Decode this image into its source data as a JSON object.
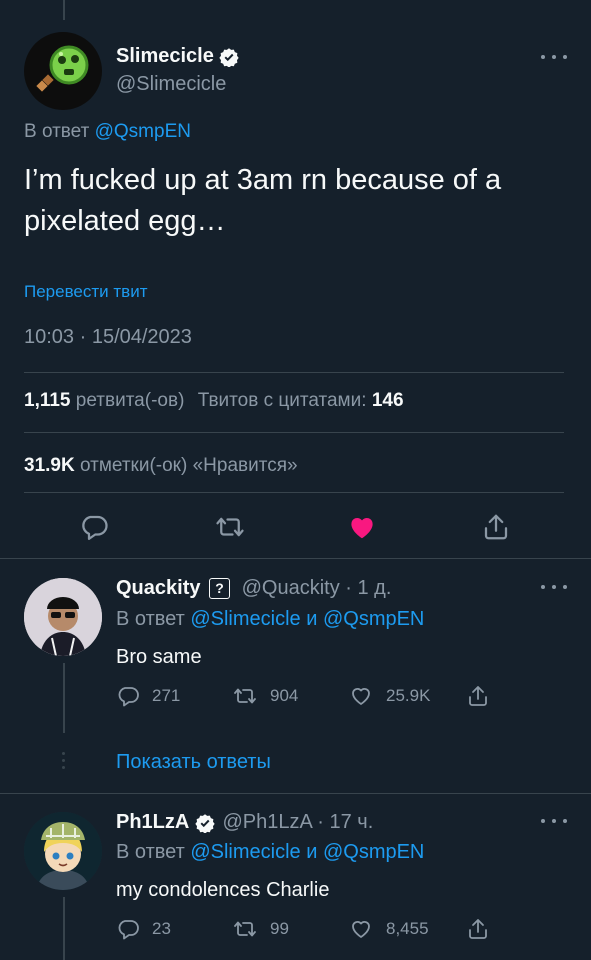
{
  "main_tweet": {
    "display_name": "Slimecicle",
    "handle": "@Slimecicle",
    "reply_prefix": "В ответ",
    "reply_to": "@QsmpEN",
    "text": "I’m fucked up at 3am rn because of a pixelated egg…",
    "translate_label": "Перевести твит",
    "timestamp": "10:03 · 15/04/2023",
    "retweets_count": "1,115",
    "retweets_label": "ретвита(-ов)",
    "quotes_label": "Твитов с цитатами:",
    "quotes_count": "146",
    "likes_count": "31.9K",
    "likes_label": "отметки(-ок) «Нравится»",
    "like_color": "#f91880"
  },
  "replies": [
    {
      "display_name": "Quackity",
      "badge": "?",
      "handle_time": "@Quackity · 1 д.",
      "reply_prefix": "В ответ",
      "reply_to_1": "@Slimecicle",
      "reply_and": "и",
      "reply_to_2": "@QsmpEN",
      "text": "Bro same",
      "replies": "271",
      "retweets": "904",
      "likes": "25.9K"
    },
    {
      "display_name": "Ph1LzA",
      "handle_time": "@Ph1LzA · 17 ч.",
      "reply_prefix": "В ответ",
      "reply_to_1": "@Slimecicle",
      "reply_and": "и",
      "reply_to_2": "@QsmpEN",
      "text": "my condolences Charlie",
      "replies": "23",
      "retweets": "99",
      "likes": "8,455"
    }
  ],
  "show_replies_label": "Показать ответы",
  "colors": {
    "background": "#15202b",
    "accent": "#1d9bf0",
    "muted": "#8b98a5"
  }
}
